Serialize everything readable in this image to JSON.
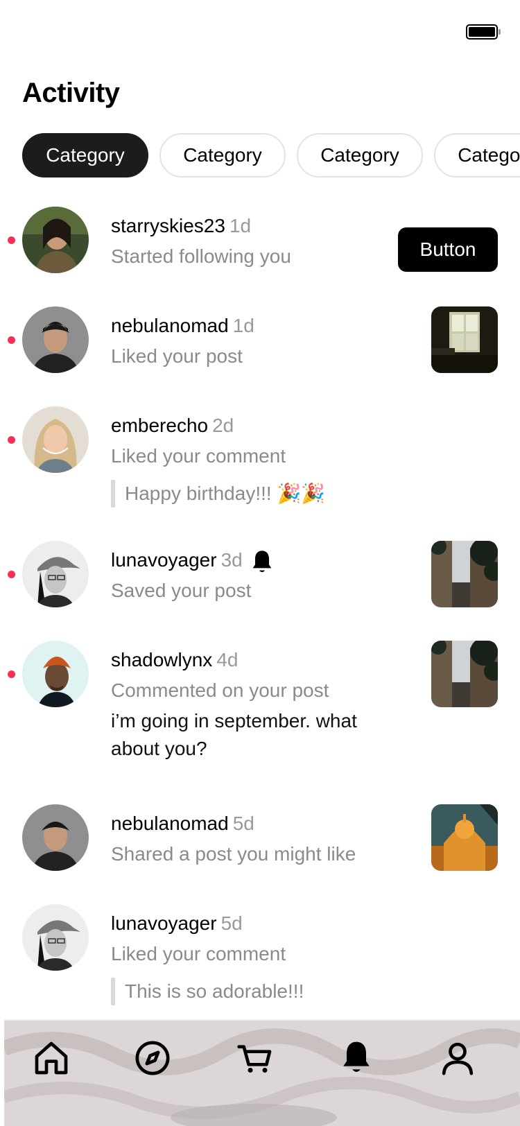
{
  "header": {
    "title": "Activity"
  },
  "categories": [
    {
      "label": "Category",
      "active": true
    },
    {
      "label": "Category",
      "active": false
    },
    {
      "label": "Category",
      "active": false
    },
    {
      "label": "Category",
      "active": false
    }
  ],
  "notifications": [
    {
      "username": "starryskies23",
      "time": "1d",
      "action": "Started following you",
      "unread": true,
      "button_label": "Button"
    },
    {
      "username": "nebulanomad",
      "time": "1d",
      "action": "Liked your post",
      "unread": true
    },
    {
      "username": "emberecho",
      "time": "2d",
      "action": "Liked your comment",
      "quote": "Happy birthday!!! 🎉🎉",
      "unread": true
    },
    {
      "username": "lunavoyager",
      "time": "3d",
      "action": "Saved your post",
      "unread": true
    },
    {
      "username": "shadowlynx",
      "time": "4d",
      "action": "Commented on your post",
      "comment": "i’m going in september. what about you?",
      "unread": true
    },
    {
      "username": "nebulanomad",
      "time": "5d",
      "action": "Shared a post you might like",
      "unread": false
    },
    {
      "username": "lunavoyager",
      "time": "5d",
      "action": "Liked your comment",
      "quote": "This is so adorable!!!",
      "unread": false
    }
  ],
  "tab_bar": {
    "items": [
      {
        "icon": "home-icon",
        "active": false
      },
      {
        "icon": "compass-icon",
        "active": false
      },
      {
        "icon": "cart-icon",
        "active": false
      },
      {
        "icon": "bell-icon",
        "active": true
      },
      {
        "icon": "profile-icon",
        "active": false
      }
    ]
  },
  "colors": {
    "unread_dot": "#ff2d55",
    "chip_active": "#1c1c1c",
    "muted_text": "#8a8a8a"
  }
}
